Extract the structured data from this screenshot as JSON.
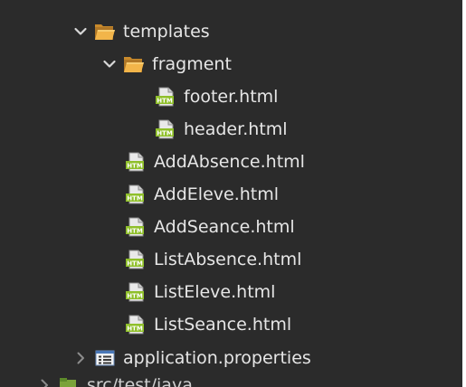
{
  "tree": {
    "templates": {
      "label": "templates",
      "icon": "folder-open-icon"
    },
    "fragment": {
      "label": "fragment",
      "icon": "folder-open-icon"
    },
    "fragment_files": [
      {
        "label": "footer.html",
        "icon": "html-file-icon"
      },
      {
        "label": "header.html",
        "icon": "html-file-icon"
      }
    ],
    "template_files": [
      {
        "label": "AddAbsence.html",
        "icon": "html-file-icon"
      },
      {
        "label": "AddEleve.html",
        "icon": "html-file-icon"
      },
      {
        "label": "AddSeance.html",
        "icon": "html-file-icon"
      },
      {
        "label": "ListAbsence.html",
        "icon": "html-file-icon"
      },
      {
        "label": "ListEleve.html",
        "icon": "html-file-icon"
      },
      {
        "label": "ListSeance.html",
        "icon": "html-file-icon"
      }
    ],
    "properties": {
      "label": "application.properties",
      "icon": "properties-file-icon"
    },
    "next_partial": {
      "label": "src/test/java",
      "icon": "package-folder-icon"
    }
  },
  "colors": {
    "background": "#2b2b2b",
    "text": "#e6e6e6",
    "folder": "#e8a33a",
    "html_icon": "#9acb3c"
  }
}
